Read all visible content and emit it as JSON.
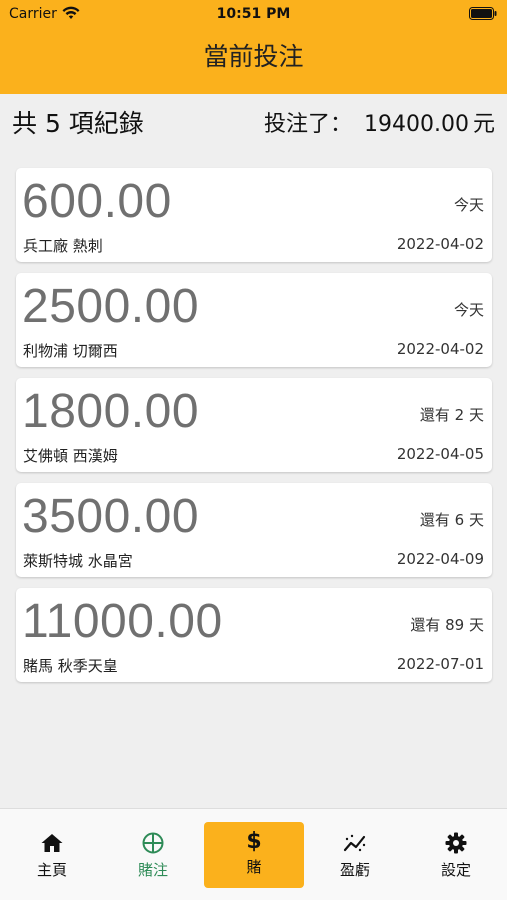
{
  "status": {
    "carrier": "Carrier",
    "time": "10:51 PM"
  },
  "header": {
    "title": "當前投注",
    "color": "#fbb11c"
  },
  "summary": {
    "count_label": "共 5 項紀錄",
    "total_label": "投注了：",
    "total_amount": "19400.00",
    "total_unit": "元"
  },
  "bets": [
    {
      "amount": "600.00",
      "teams": "兵工廠 熱刺",
      "remaining": "今天",
      "date": "2022-04-02"
    },
    {
      "amount": "2500.00",
      "teams": "利物浦 切爾西",
      "remaining": "今天",
      "date": "2022-04-02"
    },
    {
      "amount": "1800.00",
      "teams": "艾佛頓 西漢姆",
      "remaining": "還有 2 天",
      "date": "2022-04-05"
    },
    {
      "amount": "3500.00",
      "teams": "萊斯特城 水晶宮",
      "remaining": "還有 6 天",
      "date": "2022-04-09"
    },
    {
      "amount": "11000.00",
      "teams": "賭馬 秋季天皇",
      "remaining": "還有 89 天",
      "date": "2022-07-01"
    }
  ],
  "tabs": [
    {
      "label": "主頁",
      "icon": "home-icon"
    },
    {
      "label": "賭注",
      "icon": "globe-icon"
    },
    {
      "label": "賭",
      "icon": "dollar-icon"
    },
    {
      "label": "盈虧",
      "icon": "chart-icon"
    },
    {
      "label": "設定",
      "icon": "gear-icon"
    }
  ]
}
